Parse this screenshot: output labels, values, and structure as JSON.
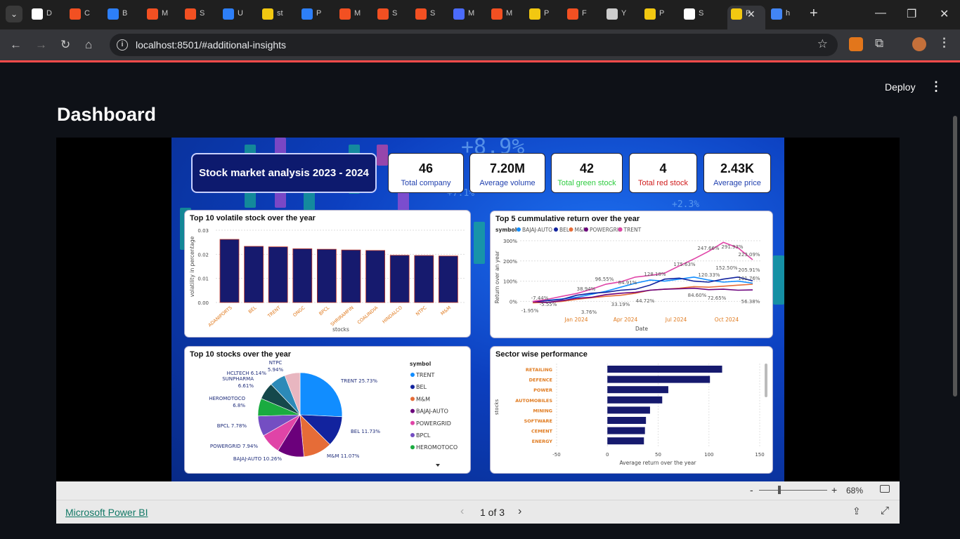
{
  "browser": {
    "tabs": [
      {
        "label": "D",
        "color": "#ffffff"
      },
      {
        "label": "C",
        "color": "#f25022"
      },
      {
        "label": "B",
        "color": "#2d7ff9"
      },
      {
        "label": "M",
        "color": "#f25022"
      },
      {
        "label": "S",
        "color": "#f25022"
      },
      {
        "label": "U",
        "color": "#2d7ff9"
      },
      {
        "label": "st",
        "color": "#f2c811"
      },
      {
        "label": "P",
        "color": "#2d7ff9"
      },
      {
        "label": "M",
        "color": "#f25022"
      },
      {
        "label": "S",
        "color": "#f25022"
      },
      {
        "label": "S",
        "color": "#f25022"
      },
      {
        "label": "M",
        "color": "#4b6bfb"
      },
      {
        "label": "M",
        "color": "#f25022"
      },
      {
        "label": "P",
        "color": "#f2c811"
      },
      {
        "label": "F",
        "color": "#f25022"
      },
      {
        "label": "Y",
        "color": "#cccccc"
      },
      {
        "label": "P",
        "color": "#f2c811"
      },
      {
        "label": "S",
        "color": "#ffffff"
      },
      {
        "label": "P",
        "color": "#f2c811",
        "active": true
      },
      {
        "label": "h",
        "color": "#4285f4"
      }
    ],
    "url": "localhost:8501/#additional-insights"
  },
  "streamlit": {
    "deploy_label": "Deploy",
    "page_title": "Dashboard"
  },
  "report": {
    "header_title": "Stock market analysis 2023 - 2024",
    "decor": {
      "big_pct": "+8.9%",
      "small_pct_1": "+7.1%",
      "small_pct_2": "+2.3%"
    },
    "kpis": [
      {
        "value": "46",
        "label": "Total company",
        "label_color": "#1f3fae"
      },
      {
        "value": "7.20M",
        "label": "Average volume",
        "label_color": "#1f3fae"
      },
      {
        "value": "42",
        "label": "Total green stock",
        "label_color": "#2ecc40"
      },
      {
        "value": "4",
        "label": "Total red stock",
        "label_color": "#d01c1c"
      },
      {
        "value": "2.43K",
        "label": "Average price",
        "label_color": "#1f3fae"
      }
    ],
    "volatile_panel_title": "Top 10 volatile stock over the year",
    "cumulative_panel_title": "Top 5 cummulative return over the year",
    "pie_panel_title": "Top 10 stocks over the year",
    "sector_panel_title": "Sector wise performance"
  },
  "chart_data": [
    {
      "type": "bar",
      "title": "Top 10 volatile stock over the year",
      "xlabel": "stocks",
      "ylabel": "volatility in percentage",
      "categories": [
        "ADANIPORTS",
        "BEL",
        "TRENT",
        "ONGC",
        "BPCL",
        "SHRIRAMFIN",
        "COALINDIA",
        "HINDALCO",
        "NTPC",
        "M&M"
      ],
      "values": [
        0.0262,
        0.0233,
        0.0231,
        0.0223,
        0.0221,
        0.0218,
        0.0216,
        0.0196,
        0.0195,
        0.0193
      ],
      "ylim": [
        0,
        0.03
      ],
      "yticks": [
        "0.00",
        "0.01",
        "0.02",
        "0.03"
      ],
      "bar_color": "#161a6e",
      "edge_color": "#c0392b"
    },
    {
      "type": "line",
      "title": "Top 5 cummulative return over the year",
      "xlabel": "Date",
      "ylabel": "Return over an year",
      "legend_title": "symbol",
      "x_ticks": [
        "Jan 2024",
        "Apr 2024",
        "Jul 2024",
        "Oct 2024"
      ],
      "yticks": [
        "0%",
        "100%",
        "200%",
        "300%"
      ],
      "ylim": [
        -30,
        300
      ],
      "series": [
        {
          "name": "BAJAJ-AUTO",
          "color": "#118dff",
          "values": [
            0,
            5,
            12,
            20,
            35,
            50,
            70,
            90,
            105,
            100,
            110,
            120,
            105,
            95,
            100,
            90
          ]
        },
        {
          "name": "BEL",
          "color": "#12239e",
          "values": [
            0,
            3,
            10,
            30,
            40,
            45,
            55,
            60,
            80,
            110,
            115,
            100,
            95,
            110,
            120,
            101.76
          ]
        },
        {
          "name": "M&M",
          "color": "#e66c37",
          "values": [
            -7.44,
            -5,
            0,
            10,
            18,
            25,
            30,
            40,
            55,
            60,
            65,
            72.65,
            70,
            75,
            80,
            84.6
          ]
        },
        {
          "name": "POWERGRID",
          "color": "#6b007b",
          "values": [
            -1.95,
            -5.5,
            3.76,
            15,
            20,
            33.19,
            40,
            44.72,
            55,
            60,
            62,
            65,
            58,
            60,
            55,
            56.38
          ]
        },
        {
          "name": "TRENT",
          "color": "#e044a7",
          "values": [
            0,
            10,
            25,
            38.94,
            60,
            84.91,
            96.55,
            120,
            128.18,
            140,
            175.63,
            210,
            247.66,
            291.93,
            265,
            205.91
          ]
        }
      ],
      "labels": [
        "-7.44%",
        "-1.95%",
        "-5.55%",
        "3.76%",
        "38.94%",
        "96.55%",
        "84.91%",
        "33.19%",
        "44.72%",
        "128.18%",
        "175.63%",
        "247.66%",
        "291.93%",
        "223.09%",
        "152.50%",
        "120.33%",
        "205.91%",
        "101.76%",
        "84.60%",
        "72.65%",
        "56.38%"
      ]
    },
    {
      "type": "pie",
      "title": "Top 10 stocks over the year",
      "legend_title": "symbol",
      "slices": [
        {
          "name": "TRENT",
          "value": 25.73,
          "color": "#118dff"
        },
        {
          "name": "BEL",
          "value": 11.73,
          "color": "#12239e"
        },
        {
          "name": "M&M",
          "value": 11.07,
          "color": "#e66c37"
        },
        {
          "name": "BAJAJ-AUTO",
          "value": 10.26,
          "color": "#6b007b"
        },
        {
          "name": "POWERGRID",
          "value": 7.94,
          "color": "#e044a7"
        },
        {
          "name": "BPCL",
          "value": 7.78,
          "color": "#744ec2"
        },
        {
          "name": "HEROMOTOCO",
          "value": 6.8,
          "color": "#1aab40"
        },
        {
          "name": "SUNPHARMA",
          "value": 6.61,
          "color": "#15484b"
        },
        {
          "name": "HCLTECH",
          "value": 6.14,
          "color": "#2c8ab8"
        },
        {
          "name": "NTPC",
          "value": 5.94,
          "color": "#e8b6c0"
        }
      ],
      "labels": [
        "TRENT 25.73%",
        "BEL 11.73%",
        "M&M 11.07%",
        "BAJAJ-AUTO 10.26%",
        "POWERGRID 7.94%",
        "BPCL 7.78%",
        "HEROMOTOCO 6.8%",
        "SUNPHARMA 6.61%",
        "HCLTECH 6.14%",
        "NTPC 5.94%"
      ],
      "legend": [
        "TRENT",
        "BEL",
        "M&M",
        "BAJAJ-AUTO",
        "POWERGRID",
        "BPCL",
        "HEROMOTOCO"
      ]
    },
    {
      "type": "bar",
      "orientation": "horizontal",
      "title": "Sector wise performance",
      "xlabel": "Average return over the year",
      "ylabel": "stocks",
      "categories": [
        "RETAILING",
        "DEFENCE",
        "POWER",
        "AUTOMOBILES",
        "MINING",
        "SOFTWARE",
        "CEMENT",
        "ENERGY"
      ],
      "values": [
        113,
        101,
        60,
        54,
        42,
        38,
        37,
        36
      ],
      "xlim": [
        -50,
        150
      ],
      "xticks": [
        "-50",
        "0",
        "50",
        "100",
        "150"
      ],
      "bar_color": "#161a6e"
    }
  ],
  "powerbi": {
    "zoom_minus": "-",
    "zoom_plus": "+",
    "zoom_level": "68%",
    "link_label": "Microsoft Power BI",
    "page_indicator": "1 of 3"
  }
}
